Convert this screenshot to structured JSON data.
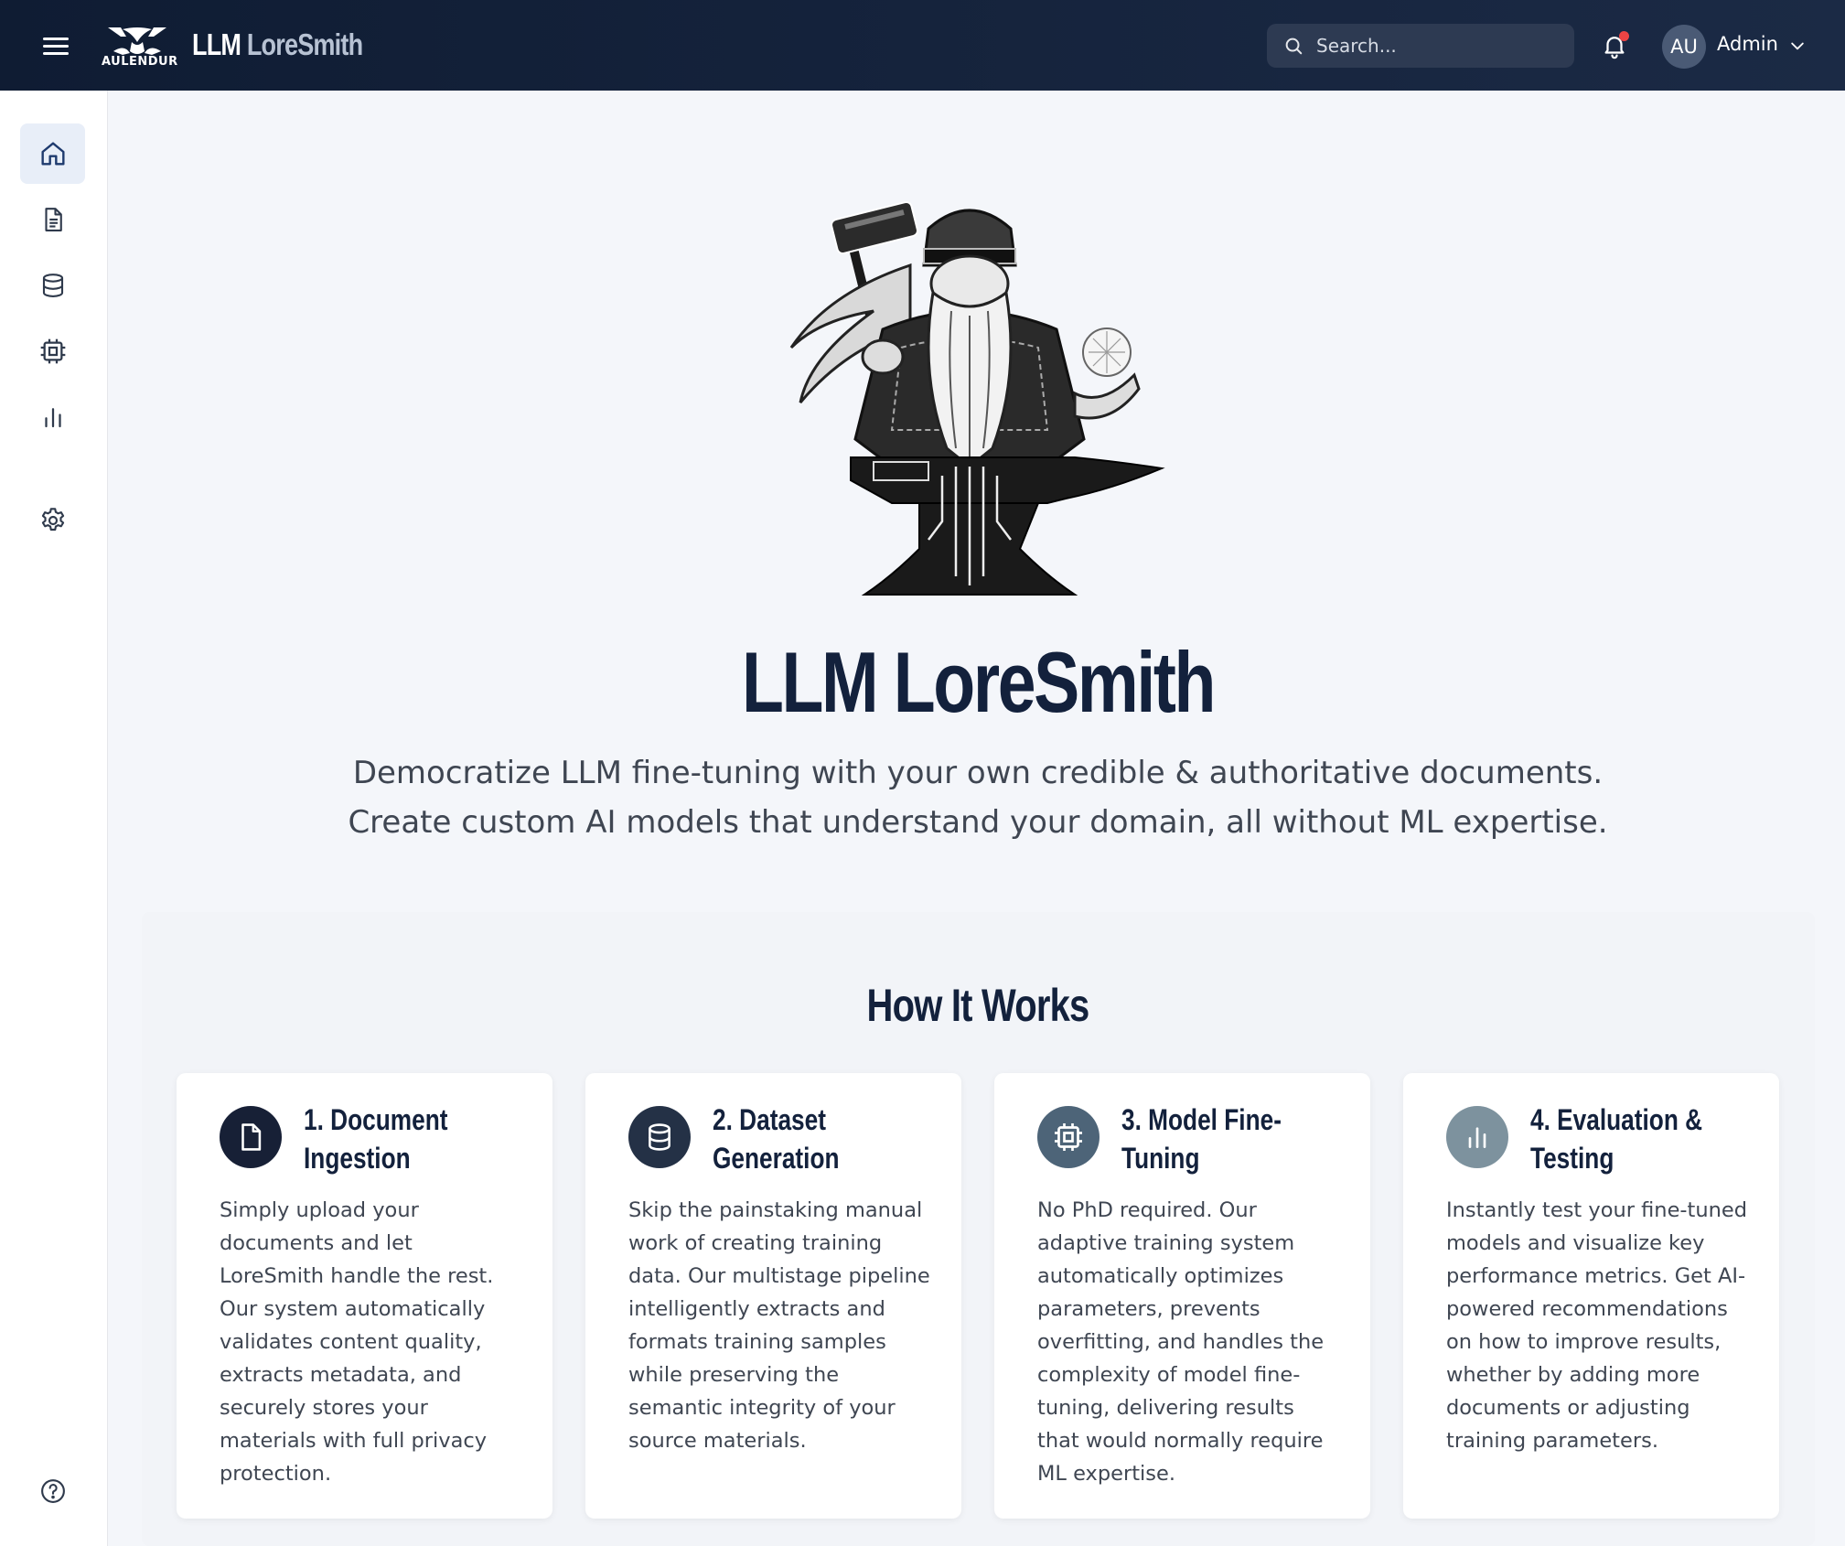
{
  "header": {
    "brand_logo_text": "AULENDUR",
    "brand_part1": "LLM",
    "brand_part2": "LoreSmith",
    "search_placeholder": "Search...",
    "avatar_initials": "AU",
    "user_name": "Admin",
    "notification_dot_color": "#ef4444"
  },
  "sidebar": {
    "items": [
      {
        "icon": "home-icon",
        "active": true
      },
      {
        "icon": "document-icon",
        "active": false
      },
      {
        "icon": "database-icon",
        "active": false
      },
      {
        "icon": "cpu-chip-icon",
        "active": false
      },
      {
        "icon": "bar-chart-icon",
        "active": false
      },
      {
        "icon": "gear-icon",
        "active": false
      },
      {
        "icon": "help-icon",
        "active": false
      }
    ]
  },
  "hero": {
    "image": "blacksmith-anvil-illustration",
    "title": "LLM LoreSmith",
    "subtitle_line1": "Democratize LLM fine-tuning with your own credible & authoritative documents.",
    "subtitle_line2": "Create custom AI models that understand your domain, all without ML expertise."
  },
  "how_it_works": {
    "title": "How It Works",
    "cards": [
      {
        "icon": "document-icon",
        "icon_color": "#172036",
        "title": "1. Document Ingestion",
        "text": "Simply upload your documents and let LoreSmith handle the rest. Our system automatically validates content quality, extracts metadata, and securely stores your materials with full privacy protection."
      },
      {
        "icon": "database-icon",
        "icon_color": "#243146",
        "title": "2. Dataset Generation",
        "text": "Skip the painstaking manual work of creating training data. Our multistage pipeline intelligently extracts and formats training samples while preserving the semantic integrity of your source materials."
      },
      {
        "icon": "cpu-chip-icon",
        "icon_color": "#4d6478",
        "title": "3. Model Fine-Tuning",
        "text": "No PhD required. Our adaptive training system automatically optimizes parameters, prevents overfitting, and handles the complexity of model fine-tuning, delivering results that would normally require ML expertise."
      },
      {
        "icon": "bar-chart-icon",
        "icon_color": "#7d929e",
        "title": "4. Evaluation & Testing",
        "text": "Instantly test your fine-tuned models and visualize key performance metrics. Get AI-powered recommendations on how to improve results, whether by adding more documents or adjusting training parameters."
      }
    ]
  }
}
